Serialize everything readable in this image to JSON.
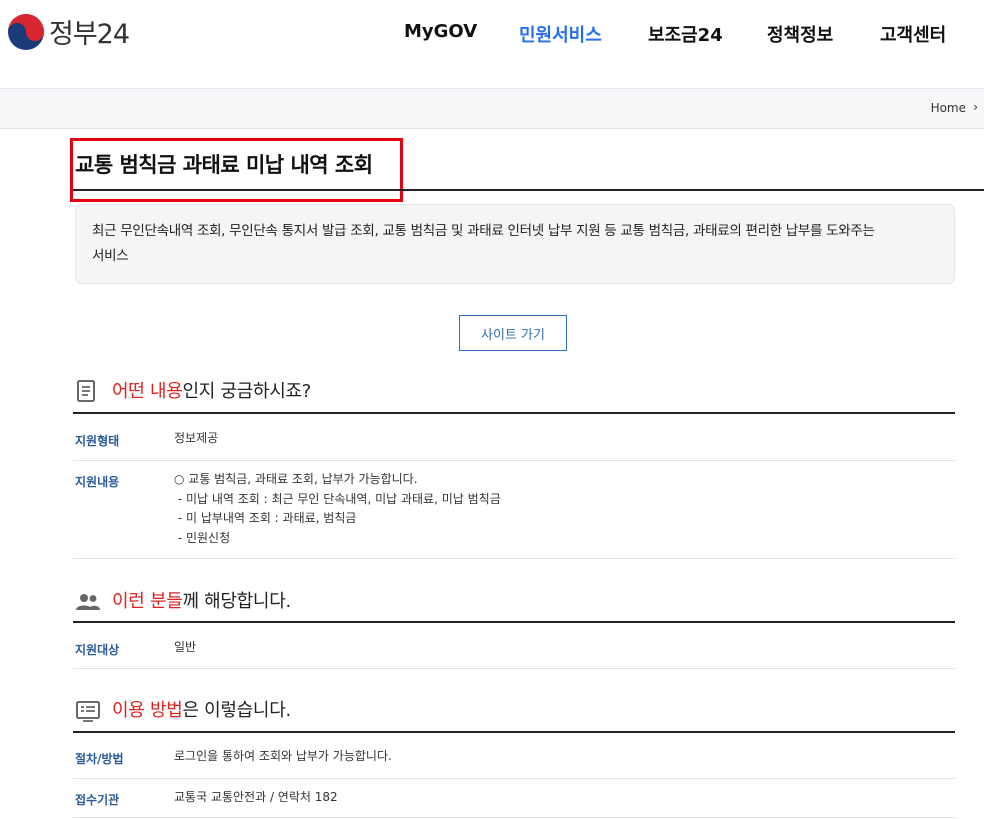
{
  "brand": {
    "name": "정부24"
  },
  "nav": {
    "items": [
      {
        "label": "MyGOV"
      },
      {
        "label": "민원서비스"
      },
      {
        "label": "보조금24"
      },
      {
        "label": "정책정보"
      },
      {
        "label": "고객센터"
      }
    ],
    "active_color": "#256ef4"
  },
  "breadcrumb": {
    "home": "Home"
  },
  "page": {
    "title": "교통 범칙금 과태료 미납 내역 조회",
    "description_line1": "최근 무인단속내역 조회, 무인단속 통지서 발급 조회, 교통 범칙금 및 과태료 인터넷 납부 지원 등 교통 범칙금, 과태료의 편리한 납부를 도와주는",
    "description_line2": "서비스",
    "site_button": "사이트 가기"
  },
  "section_what": {
    "title_accent": "어떤 내용",
    "title_rest": "인지 궁금하시죠?",
    "icon": "document-icon",
    "rows": [
      {
        "label": "지원형태",
        "lines": [
          "정보제공"
        ]
      },
      {
        "label": "지원내용",
        "lines": [
          "○ 교통 범칙금, 과태료 조회, 납부가 가능합니다.",
          " - 미납 내역 조회 : 최근 무인 단속내역, 미납 과태료, 미납 범칙금",
          " - 미 납부내역 조회 : 과태료, 범칙금",
          " - 민원신청"
        ]
      }
    ]
  },
  "section_who": {
    "title_accent": "이런 분들",
    "title_rest": "께 해당합니다.",
    "icon": "people-icon",
    "rows": [
      {
        "label": "지원대상",
        "lines": [
          "일반"
        ]
      }
    ]
  },
  "section_how": {
    "title_accent": "이용 방법",
    "title_rest": "은 이렇습니다.",
    "icon": "list-card-icon",
    "rows": [
      {
        "label": "절차/방법",
        "lines": [
          "로그인을 통하여 조회와 납부가 가능합니다."
        ]
      },
      {
        "label": "접수기관",
        "lines": [
          "교통국 교통안전과 / 연락처 182"
        ]
      }
    ]
  },
  "colors": {
    "accent_red": "#e0231f",
    "label_blue": "#2a5a9a",
    "button_blue": "#2d6fb8"
  }
}
